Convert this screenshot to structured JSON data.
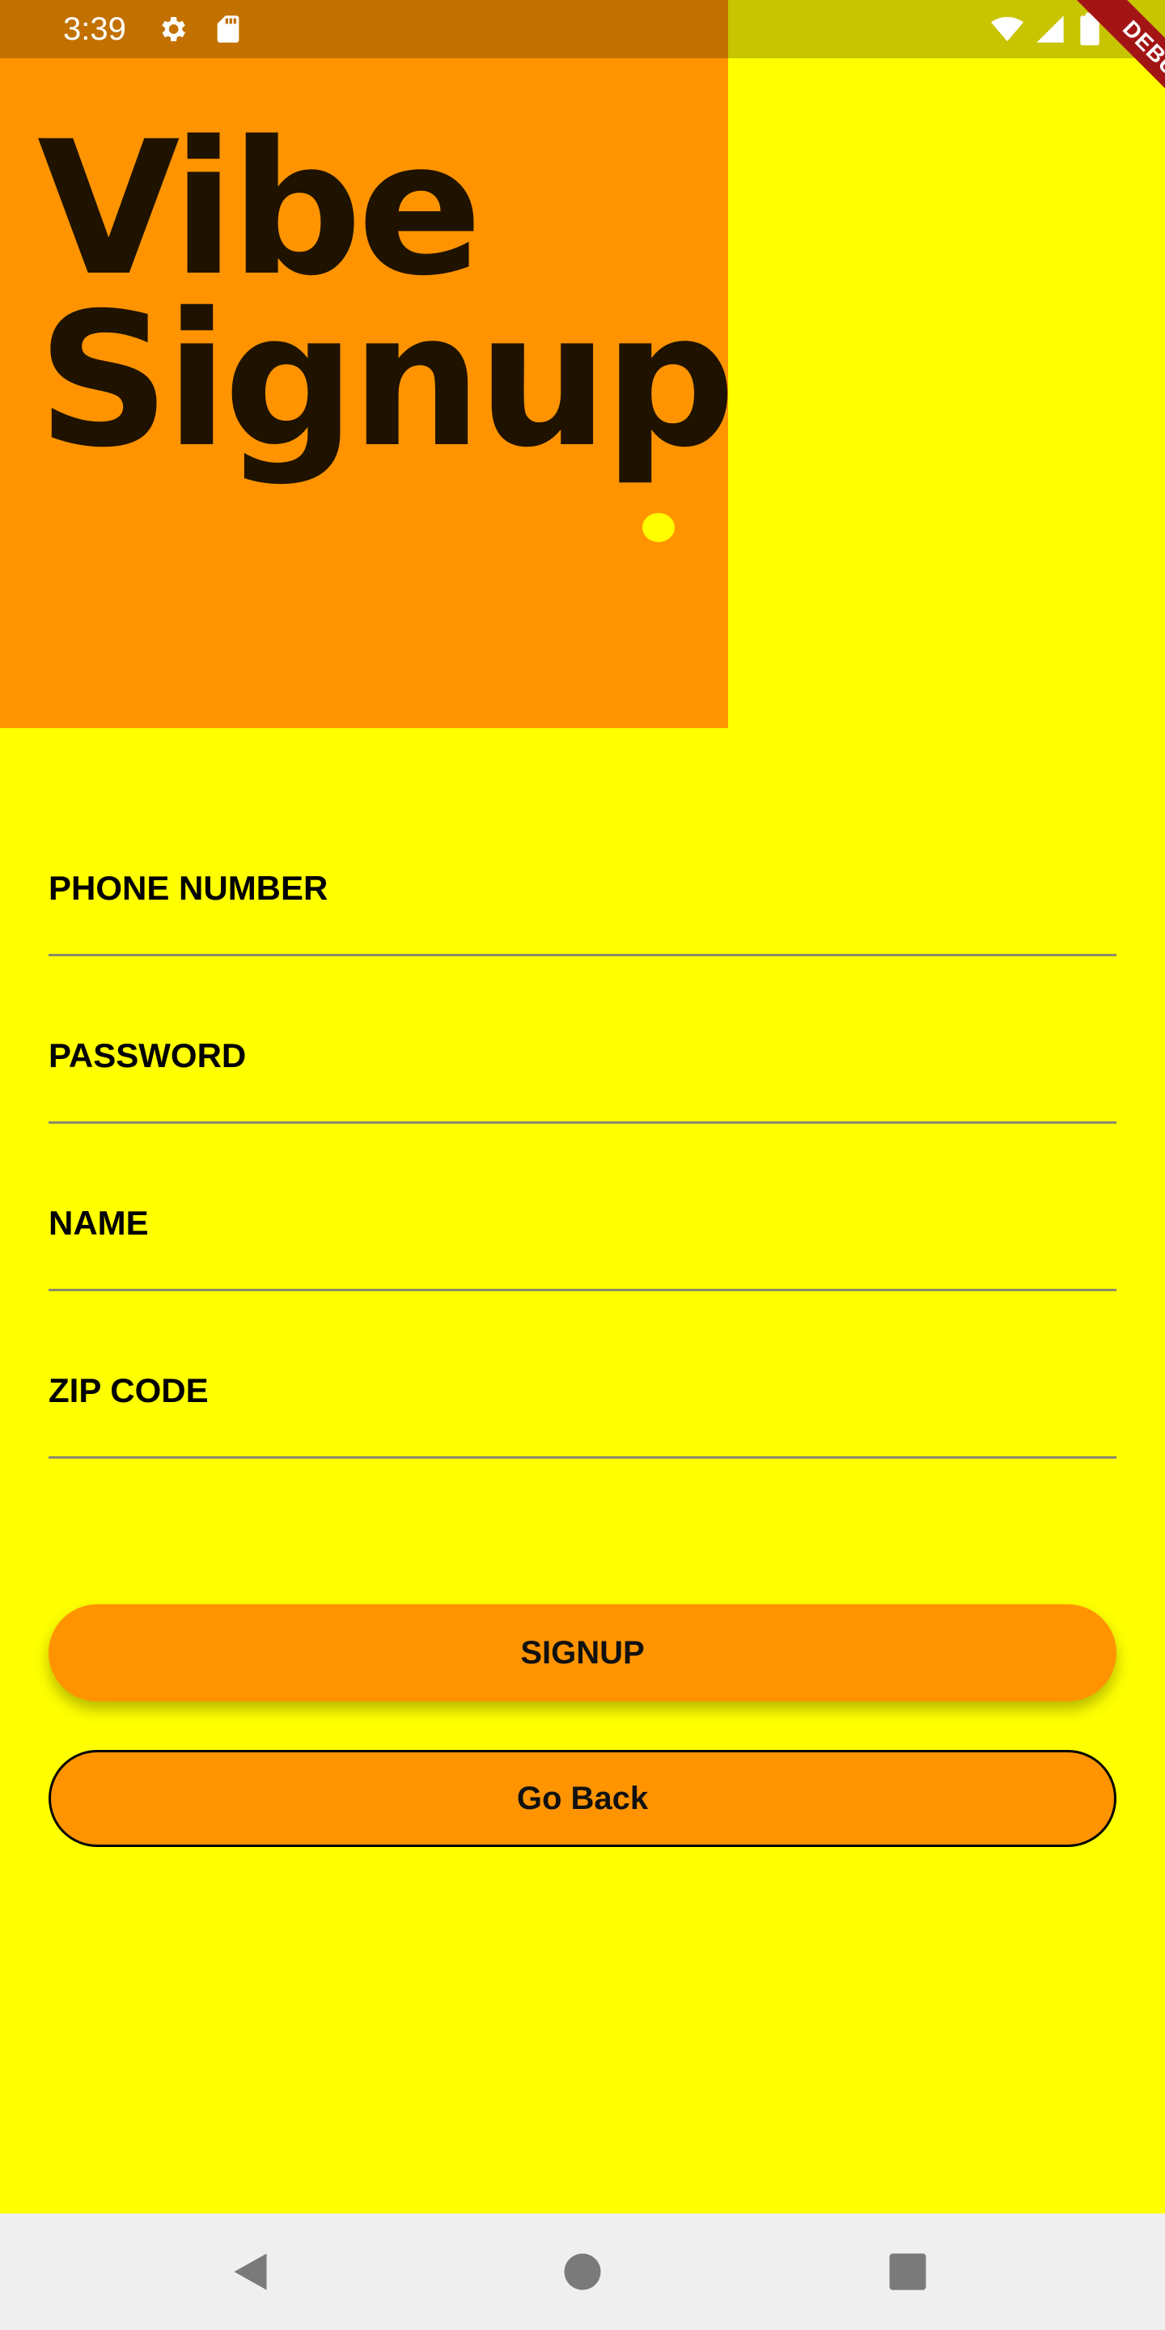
{
  "status_bar": {
    "time": "3:39",
    "icons_left": [
      "gear-icon",
      "sd-card-icon"
    ],
    "icons_right": [
      "wifi-icon",
      "signal-icon",
      "battery-icon"
    ]
  },
  "debug_banner": {
    "label": "DEBUG"
  },
  "header": {
    "title_line1": "Vibe",
    "title_line2": "Signup",
    "colors": {
      "background": "#FF9400",
      "text": "#1F1300",
      "dot": "#FFFF00"
    }
  },
  "form": {
    "fields": [
      {
        "label": "PHONE NUMBER",
        "value": ""
      },
      {
        "label": "PASSWORD",
        "value": ""
      },
      {
        "label": "NAME",
        "value": ""
      },
      {
        "label": "ZIP CODE",
        "value": ""
      }
    ]
  },
  "actions": {
    "signup_label": "SIGNUP",
    "back_label": "Go Back"
  },
  "nav_bar": {
    "icons": [
      "back-triangle-icon",
      "home-circle-icon",
      "recents-square-icon"
    ]
  },
  "colors": {
    "page_background": "#FFFF00",
    "accent": "#FF9400"
  }
}
